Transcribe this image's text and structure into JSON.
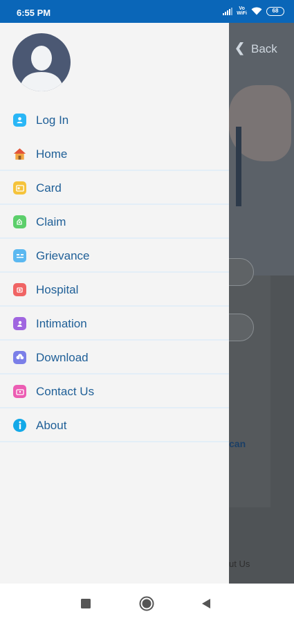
{
  "status_bar": {
    "time": "6:55 PM",
    "volte_line1": "Vo",
    "volte_line2": "WiFi",
    "battery": "68"
  },
  "background_app": {
    "back_label": "Back",
    "partial_text_1": "can",
    "partial_text_2": "ut Us"
  },
  "drawer": {
    "menu": [
      {
        "label": "Log In",
        "icon": "login-user-icon",
        "color": "#29b6f6"
      },
      {
        "label": "Home",
        "icon": "home-icon",
        "color": "#e8734a"
      },
      {
        "label": "Card",
        "icon": "card-icon",
        "color": "#f5c33b"
      },
      {
        "label": "Claim",
        "icon": "claim-icon",
        "color": "#5ccf6b"
      },
      {
        "label": "Grievance",
        "icon": "grievance-icon",
        "color": "#5bb8f0"
      },
      {
        "label": "Hospital",
        "icon": "hospital-icon",
        "color": "#f06464"
      },
      {
        "label": "Intimation",
        "icon": "intimation-icon",
        "color": "#a065e0"
      },
      {
        "label": "Download",
        "icon": "download-icon",
        "color": "#7b7fe8"
      },
      {
        "label": "Contact Us",
        "icon": "contact-icon",
        "color": "#ec5db3"
      },
      {
        "label": "About",
        "icon": "info-icon",
        "color": "#13a9e8"
      }
    ]
  },
  "nav_bar": {
    "buttons": [
      "recents-button",
      "home-button",
      "back-button"
    ]
  }
}
